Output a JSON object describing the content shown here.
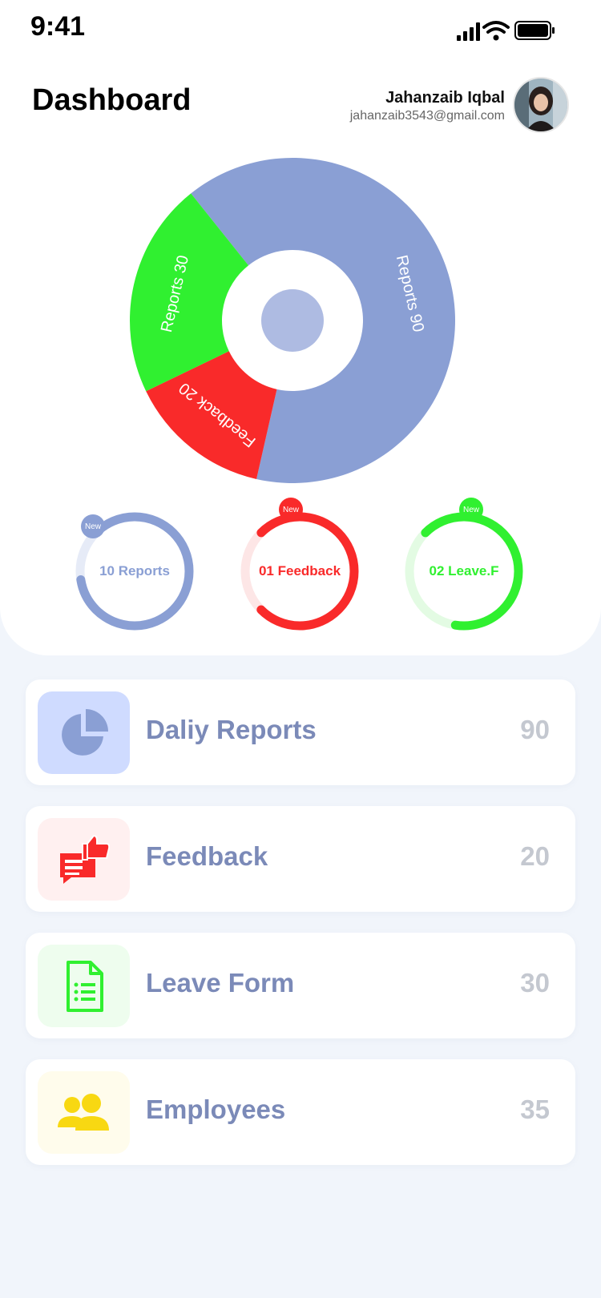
{
  "status_bar": {
    "time": "9:41"
  },
  "header": {
    "title": "Dashboard",
    "user_name": "Jahanzaib Iqbal",
    "user_email": "jahanzaib3543@gmail.com"
  },
  "donut": {
    "segments": [
      {
        "label": "Reports 90",
        "value": 90,
        "color": "#8a9fd4"
      },
      {
        "label": "Feedback 20",
        "value": 20,
        "color": "#f92a2a"
      },
      {
        "label": "Reports 30",
        "value": 30,
        "color": "#30f030"
      }
    ]
  },
  "rings": [
    {
      "label": "10 Reports",
      "badge": "New",
      "color": "#8a9fd4",
      "track": "#e6ebf7",
      "progress": 0.85
    },
    {
      "label": "01 Feedback",
      "badge": "New",
      "color": "#f92a2a",
      "track": "#fde6e6",
      "progress": 0.75
    },
    {
      "label": "02 Leave.F",
      "badge": "New",
      "color": "#30f030",
      "track": "#e3fbe3",
      "progress": 0.65
    }
  ],
  "list": [
    {
      "label": "Daliy Reports",
      "value": "90",
      "icon": "pie-chart-icon",
      "color": "#8a9fd4",
      "bg": "#cfdbff"
    },
    {
      "label": "Feedback",
      "value": "20",
      "icon": "feedback-thumbs-up-icon",
      "color": "#f92a2a",
      "bg": "#fff0f0"
    },
    {
      "label": "Leave Form",
      "value": "30",
      "icon": "document-list-icon",
      "color": "#30f030",
      "bg": "#eefdee"
    },
    {
      "label": "Employees",
      "value": "35",
      "icon": "users-icon",
      "color": "#f8d812",
      "bg": "#fffcec"
    }
  ]
}
